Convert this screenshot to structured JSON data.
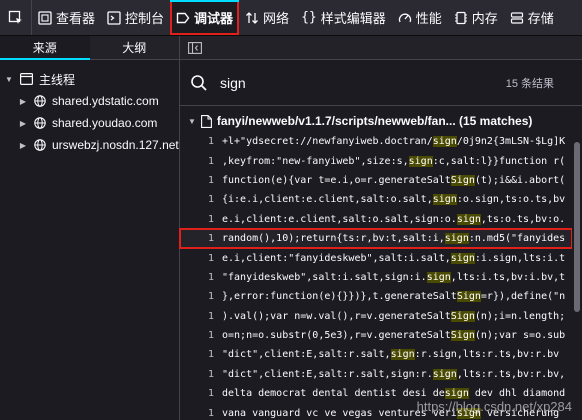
{
  "toolbar": {
    "tabs": [
      {
        "label": "查看器",
        "icon": "inspector-icon"
      },
      {
        "label": "控制台",
        "icon": "console-icon"
      },
      {
        "label": "调试器",
        "icon": "debugger-icon"
      },
      {
        "label": "网络",
        "icon": "network-icon"
      },
      {
        "label": "样式编辑器",
        "icon": "style-editor-icon"
      },
      {
        "label": "性能",
        "icon": "performance-icon"
      },
      {
        "label": "内存",
        "icon": "memory-icon"
      },
      {
        "label": "存储",
        "icon": "storage-icon"
      }
    ],
    "active_tab": "调试器"
  },
  "left_panel": {
    "tabs": [
      "来源",
      "大纲"
    ],
    "active_tab": "来源",
    "root_label": "主线程",
    "sources": [
      "shared.ydstatic.com",
      "shared.youdao.com",
      "urswebzj.nosdn.127.net"
    ]
  },
  "search": {
    "value": "sign",
    "result_count": "15 条结果"
  },
  "file": {
    "title": "fanyi/newweb/v1.1.7/scripts/newweb/fan... (15 matches)"
  },
  "results": [
    {
      "line": "1",
      "before": "+l+\"ydsecret://newfanyiweb.doctran/",
      "match": "sign",
      "after": "/0j9n2{3mLSN-$Lg]K"
    },
    {
      "line": "1",
      "before": ",keyfrom:\"new-fanyiweb\",size:s,",
      "match": "sign",
      "after": ":c,salt:l}}function r("
    },
    {
      "line": "1",
      "before": "function(e){var t=e.i,o=r.generateSalt",
      "match": "Sign",
      "after": "(t);i&&i.abort("
    },
    {
      "line": "1",
      "before": "{i:e.i,client:e.client,salt:o.salt,",
      "match": "sign",
      "after": ":o.sign,ts:o.ts,bv"
    },
    {
      "line": "1",
      "before": "e.i,client:e.client,salt:o.salt,sign:o.",
      "match": "sign",
      "after": ",ts:o.ts,bv:o."
    },
    {
      "line": "1",
      "before": "random(),10);return{ts:r,bv:t,salt:i,",
      "match": "sign",
      "after": ":n.md5(\"fanyides"
    },
    {
      "line": "1",
      "before": "e.i,client:\"fanyideskweb\",salt:i.salt,",
      "match": "sign",
      "after": ":i.sign,lts:i.t"
    },
    {
      "line": "1",
      "before": "\"fanyideskweb\",salt:i.salt,sign:i.",
      "match": "sign",
      "after": ",lts:i.ts,bv:i.bv,t"
    },
    {
      "line": "1",
      "before": "},error:function(e){}})},t.generateSalt",
      "match": "Sign",
      "after": "=r}),define(\"n"
    },
    {
      "line": "1",
      "before": ").val();var n=w.val(),r=v.generateSalt",
      "match": "Sign",
      "after": "(n);i=n.length;"
    },
    {
      "line": "1",
      "before": "o=n;n=o.substr(0,5e3),r=v.generateSalt",
      "match": "Sign",
      "after": "(n);var s=o.sub"
    },
    {
      "line": "1",
      "before": "\"dict\",client:E,salt:r.salt,",
      "match": "sign",
      "after": ":r.sign,lts:r.ts,bv:r.bv"
    },
    {
      "line": "1",
      "before": "\"dict\",client:E,salt:r.salt,sign:r.",
      "match": "sign",
      "after": ",lts:r.ts,bv:r.bv,"
    },
    {
      "line": "1",
      "before": "delta democrat dental dentist desi de",
      "match": "sign",
      "after": " dev dhl diamond"
    },
    {
      "line": "1",
      "before": "vana vanguard vc ve vegas ventures veri",
      "match": "sign",
      "after": " versicherung"
    }
  ],
  "watermark": "https://blog.csdn.net/xp284",
  "colors": {
    "highlight_border": "#e0201b",
    "accent": "#00ddff",
    "match_bg": "#4a4a00"
  }
}
